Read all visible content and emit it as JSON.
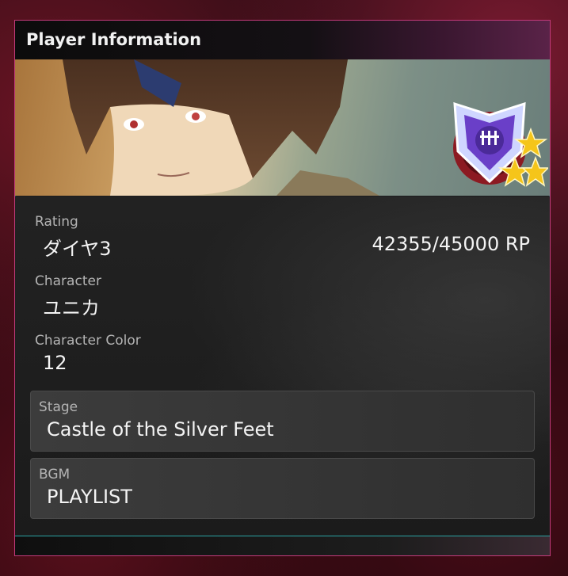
{
  "panel": {
    "title": "Player Information"
  },
  "fields": {
    "rating": {
      "label": "Rating",
      "value": "ダイヤ3",
      "points": "42355/45000 RP"
    },
    "character": {
      "label": "Character",
      "value": "ユニカ"
    },
    "character_color": {
      "label": "Character Color",
      "value": "12"
    },
    "stage": {
      "label": "Stage",
      "value": "Castle of the Silver Feet"
    },
    "bgm": {
      "label": "BGM",
      "value": "PLAYLIST"
    }
  },
  "rank_emblem": {
    "icon": "diamond-rank-emblem-icon",
    "stars": 3
  },
  "colors": {
    "panel_border": "#c23a7a",
    "star": "#f5c51a",
    "emblem_purple": "#6a3fc8"
  }
}
